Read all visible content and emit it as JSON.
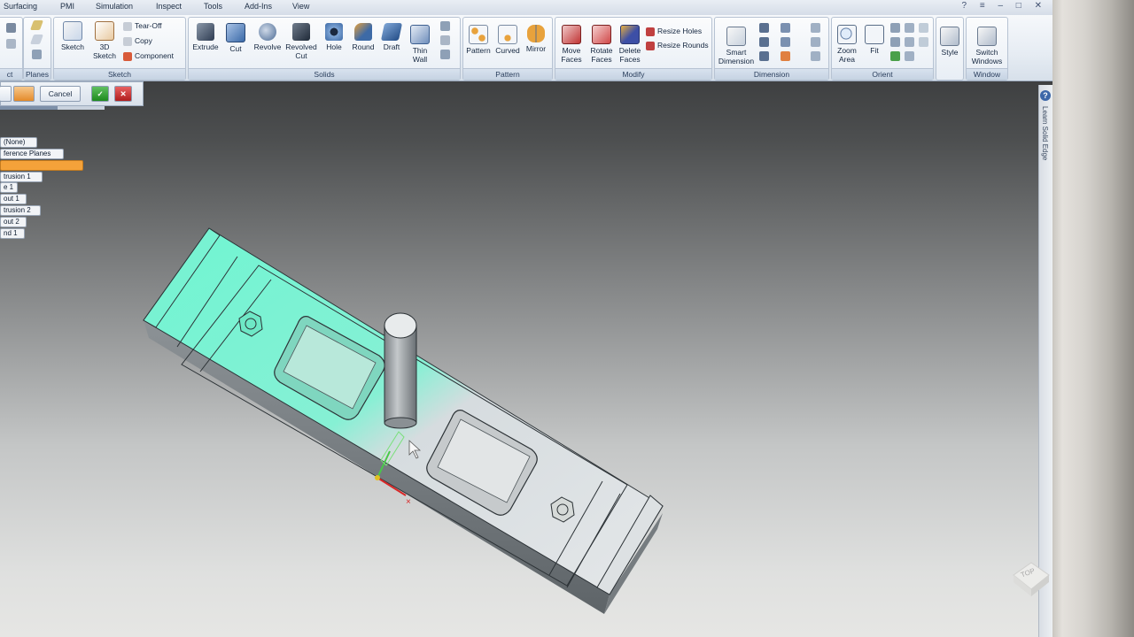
{
  "tabs": [
    "Surfacing",
    "PMI",
    "Simulation",
    "Inspect",
    "Tools",
    "Add-Ins",
    "View"
  ],
  "window_controls": "? ≡ ‒ □ ✕",
  "ribbon": {
    "groups": {
      "planes": "Planes",
      "sketch": "Sketch",
      "solids": "Solids",
      "pattern": "Pattern",
      "modify": "Modify",
      "dimension": "Dimension",
      "orient": "Orient",
      "window": "Window"
    },
    "left_partial": "ct",
    "sketch_buttons": {
      "sketch": "Sketch",
      "sketch3d_1": "3D",
      "sketch3d_2": "Sketch",
      "tearoff": "Tear-Off",
      "copy": "Copy",
      "component": "Component"
    },
    "solids_buttons": {
      "extrude": "Extrude",
      "cut": "Cut",
      "revolve": "Revolve",
      "revolved_cut_1": "Revolved",
      "revolved_cut_2": "Cut",
      "hole": "Hole",
      "round": "Round",
      "draft": "Draft",
      "thin_wall_1": "Thin",
      "thin_wall_2": "Wall"
    },
    "pattern_buttons": {
      "pattern": "Pattern",
      "curved": "Curved",
      "mirror": "Mirror"
    },
    "modify_buttons": {
      "move_faces_1": "Move",
      "move_faces_2": "Faces",
      "rotate_faces_1": "Rotate",
      "rotate_faces_2": "Faces",
      "delete_faces_1": "Delete",
      "delete_faces_2": "Faces",
      "resize_holes": "Resize Holes",
      "resize_rounds": "Resize Rounds"
    },
    "dimension_buttons": {
      "smart_dim_1": "Smart",
      "smart_dim_2": "Dimension"
    },
    "orient_buttons": {
      "zoom_area_1": "Zoom",
      "zoom_area_2": "Area",
      "fit": "Fit"
    },
    "style_button": "Style",
    "window_buttons": {
      "switch_1": "Switch",
      "switch_2": "Windows"
    }
  },
  "command_bar": {
    "cancel": "Cancel",
    "accept": "✓",
    "reject": "✕"
  },
  "progress": 0.55,
  "pathfinder": [
    {
      "label": "(None)",
      "selected": false
    },
    {
      "label": "ference Planes",
      "selected": false
    },
    {
      "label": "",
      "selected": true
    },
    {
      "label": "trusion 1",
      "selected": false
    },
    {
      "label": "e 1",
      "selected": false
    },
    {
      "label": "out 1",
      "selected": false
    },
    {
      "label": "trusion 2",
      "selected": false
    },
    {
      "label": "out 2",
      "selected": false
    },
    {
      "label": "nd 1",
      "selected": false
    }
  ],
  "side_strip_text": "Learn Solid Edge",
  "help_glyph": "?",
  "viewcube_label": "TOP",
  "colors": {
    "selection_face": "#5ff0c8",
    "model_face": "#c8ccd0",
    "accent_orange": "#f4a23a"
  }
}
